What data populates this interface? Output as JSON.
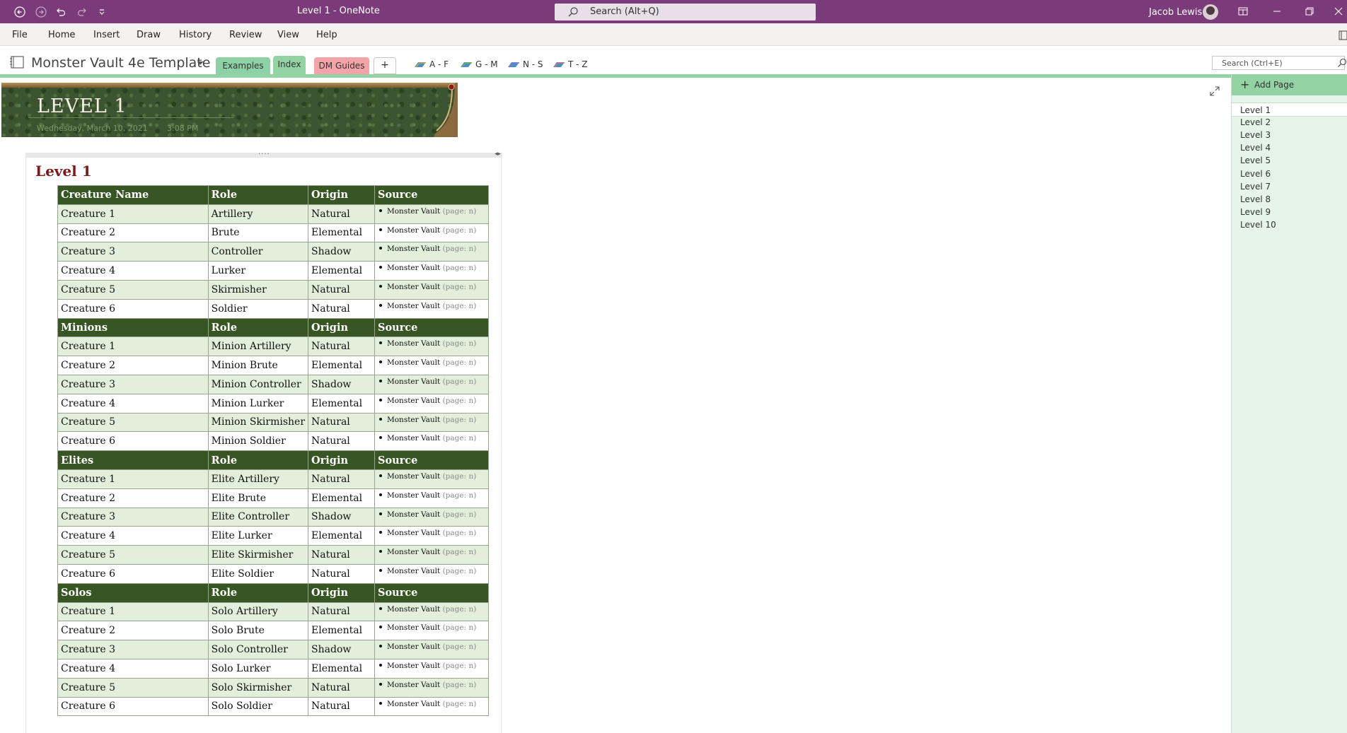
{
  "app": {
    "window_title": "Level 1  -  OneNote",
    "search_placeholder": "Search (Alt+Q)",
    "user_name": "Jacob Lewis"
  },
  "menu": [
    "File",
    "Home",
    "Insert",
    "Draw",
    "History",
    "Review",
    "View",
    "Help"
  ],
  "notebook": {
    "name": "Monster Vault 4e Template",
    "sections": [
      {
        "label": "Examples",
        "color": "#8fd1a6"
      },
      {
        "label": "Index",
        "color": "#93d2a3"
      },
      {
        "label": "DM Guides",
        "color": "#f4a3a8"
      }
    ],
    "add_section_label": "+",
    "section_groups": [
      "A - F",
      "G - M",
      "N - S",
      "T - Z"
    ],
    "search_placeholder": "Search (Ctrl+E)"
  },
  "page": {
    "title": "LEVEL 1",
    "date": "Wednesday, March 10, 2021",
    "time": "3:08 PM",
    "heading": "Level 1"
  },
  "table": {
    "groups": [
      {
        "header": [
          "Creature Name",
          "Role",
          "Origin",
          "Source"
        ],
        "rows": [
          [
            "Creature 1",
            "Artillery",
            "Natural"
          ],
          [
            "Creature 2",
            "Brute",
            "Elemental"
          ],
          [
            "Creature 3",
            "Controller",
            "Shadow"
          ],
          [
            "Creature 4",
            "Lurker",
            "Elemental"
          ],
          [
            "Creature 5",
            "Skirmisher",
            "Natural"
          ],
          [
            "Creature 6",
            "Soldier",
            "Natural"
          ]
        ]
      },
      {
        "header": [
          "Minions",
          "Role",
          "Origin",
          "Source"
        ],
        "rows": [
          [
            "Creature 1",
            "Minion Artillery",
            "Natural"
          ],
          [
            "Creature 2",
            "Minion Brute",
            "Elemental"
          ],
          [
            "Creature 3",
            "Minion Controller",
            "Shadow"
          ],
          [
            "Creature 4",
            "Minion Lurker",
            "Elemental"
          ],
          [
            "Creature 5",
            "Minion Skirmisher",
            "Natural"
          ],
          [
            "Creature 6",
            "Minion Soldier",
            "Natural"
          ]
        ]
      },
      {
        "header": [
          "Elites",
          "Role",
          "Origin",
          "Source"
        ],
        "rows": [
          [
            "Creature 1",
            "Elite Artillery",
            "Natural"
          ],
          [
            "Creature 2",
            "Elite Brute",
            "Elemental"
          ],
          [
            "Creature 3",
            "Elite Controller",
            "Shadow"
          ],
          [
            "Creature 4",
            "Elite Lurker",
            "Elemental"
          ],
          [
            "Creature 5",
            "Elite Skirmisher",
            "Natural"
          ],
          [
            "Creature 6",
            "Elite Soldier",
            "Natural"
          ]
        ]
      },
      {
        "header": [
          "Solos",
          "Role",
          "Origin",
          "Source"
        ],
        "rows": [
          [
            "Creature 1",
            "Solo Artillery",
            "Natural"
          ],
          [
            "Creature 2",
            "Solo Brute",
            "Elemental"
          ],
          [
            "Creature 3",
            "Solo Controller",
            "Shadow"
          ],
          [
            "Creature 4",
            "Solo Lurker",
            "Elemental"
          ],
          [
            "Creature 5",
            "Solo Skirmisher",
            "Natural"
          ],
          [
            "Creature 6",
            "Solo Soldier",
            "Natural"
          ]
        ]
      }
    ],
    "source_book": "Monster Vault",
    "source_page": "(page: n)"
  },
  "pages_pane": {
    "add_label": "Add Page",
    "pages": [
      "Level 1",
      "Level 2",
      "Level 3",
      "Level 4",
      "Level 5",
      "Level 6",
      "Level 7",
      "Level 8",
      "Level 9",
      "Level 10"
    ],
    "active_index": 0
  },
  "colors": {
    "titlebar": "#7b3a7a",
    "header_row": "#375623",
    "odd_row": "#e2efda",
    "section_heading": "#7a1a1a",
    "pane_bg": "#e6f4ea"
  }
}
